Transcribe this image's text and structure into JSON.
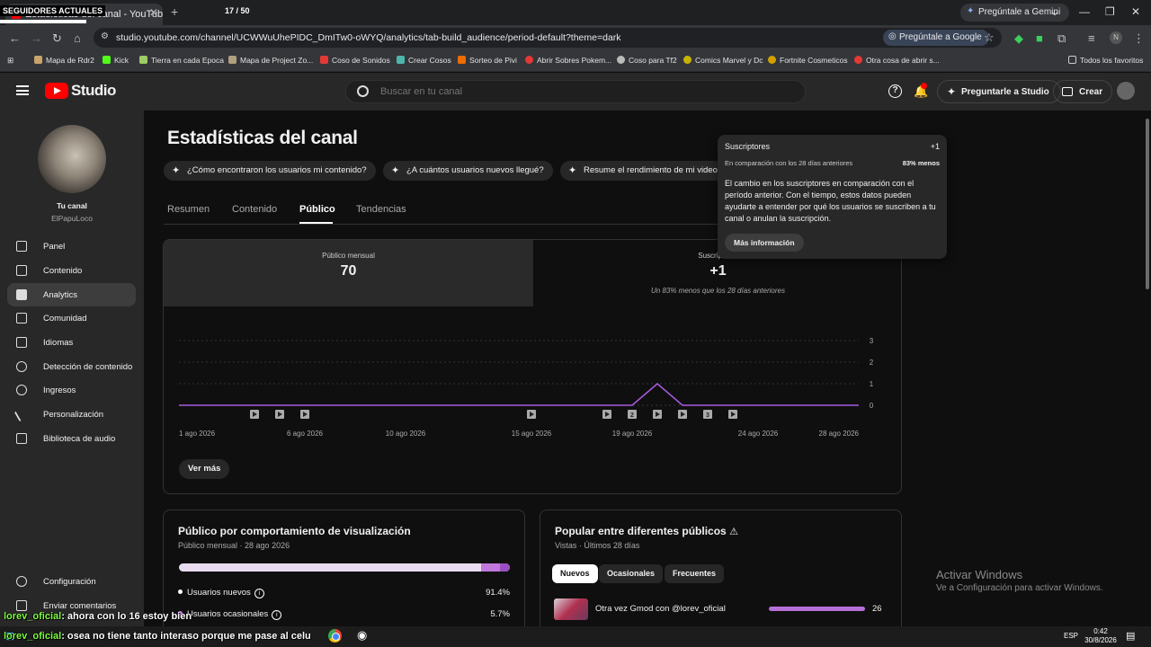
{
  "overlay": {
    "seguidores_label": "SEGUIDORES ACTUALES",
    "counter": "17 / 50"
  },
  "browser": {
    "tab_title": "Estadísticas del canal - YouTube",
    "gemini_button": "Pregúntale a Gemini",
    "url": "studio.youtube.com/channel/UCWWuUhePIDC_DmITw0-oWYQ/analytics/tab-build_audience/period-default?theme=dark",
    "ask_google": "Pregúntale a Google",
    "profile_initial": "N",
    "bookmarks": [
      "Mapa de Rdr2",
      "Kick",
      "Tierra en cada Epoca",
      "Mapa de Project Zo...",
      "Coso de Sonidos",
      "Crear Cosos",
      "Sorteo de Pivi",
      "Abrir Sobres Pokem...",
      "Coso para Tf2",
      "Comics Marvel y Dc",
      "Fortnite Cosmeticos",
      "Otra cosa de abrir s..."
    ],
    "bookmarks_all": "Todos los favoritos"
  },
  "header": {
    "logo_text": "Studio",
    "search_placeholder": "Buscar en tu canal",
    "ask_studio": "Preguntarle a Studio",
    "create": "Crear"
  },
  "sidebar": {
    "tu_canal": "Tu canal",
    "channel_name": "ElPapuLoco",
    "items": [
      {
        "label": "Panel",
        "icon": "dashboard-icon"
      },
      {
        "label": "Contenido",
        "icon": "content-icon"
      },
      {
        "label": "Analytics",
        "icon": "analytics-icon"
      },
      {
        "label": "Comunidad",
        "icon": "community-icon"
      },
      {
        "label": "Idiomas",
        "icon": "subtitles-icon"
      },
      {
        "label": "Detección de contenido",
        "icon": "copyright-icon"
      },
      {
        "label": "Ingresos",
        "icon": "earn-icon"
      },
      {
        "label": "Personalización",
        "icon": "customization-icon"
      },
      {
        "label": "Biblioteca de audio",
        "icon": "audio-library-icon"
      }
    ],
    "settings": "Configuración",
    "feedback": "Enviar comentarios"
  },
  "main": {
    "title": "Estadísticas del canal",
    "chips": [
      "¿Cómo encontraron los usuarios mi contenido?",
      "¿A cuántos usuarios nuevos llegué?",
      "Resume el rendimiento de mi video"
    ],
    "tabs": [
      "Resumen",
      "Contenido",
      "Público",
      "Tendencias"
    ],
    "active_tab": "Público",
    "metric_left": {
      "label": "Público mensual",
      "value": "70"
    },
    "metric_right": {
      "label": "Suscriptores",
      "value": "+1",
      "sub": "Un 83% menos que los 28 días anteriores"
    },
    "ver_mas": "Ver más"
  },
  "chart_data": {
    "type": "line",
    "x_ticks": [
      "1 ago 2026",
      "6 ago 2026",
      "10 ago 2026",
      "15 ago 2026",
      "19 ago 2026",
      "24 ago 2026",
      "28 ago 2026"
    ],
    "y_ticks": [
      "3",
      "2",
      "1",
      "0"
    ],
    "ylim": [
      0,
      3
    ],
    "series": [
      {
        "color": "#a95be0",
        "x": [
          "2026-08-01",
          "2026-08-02",
          "2026-08-03",
          "2026-08-04",
          "2026-08-05",
          "2026-08-06",
          "2026-08-07",
          "2026-08-08",
          "2026-08-09",
          "2026-08-10",
          "2026-08-11",
          "2026-08-12",
          "2026-08-13",
          "2026-08-14",
          "2026-08-15",
          "2026-08-16",
          "2026-08-17",
          "2026-08-18",
          "2026-08-19",
          "2026-08-20",
          "2026-08-21",
          "2026-08-22",
          "2026-08-23",
          "2026-08-24",
          "2026-08-25",
          "2026-08-26",
          "2026-08-27",
          "2026-08-28"
        ],
        "values": [
          0,
          0,
          0,
          0,
          0,
          0,
          0,
          0,
          0,
          0,
          0,
          0,
          0,
          0,
          0,
          0,
          0,
          0,
          0,
          1,
          0,
          0,
          0,
          0,
          0,
          0,
          0,
          0
        ]
      }
    ],
    "video_markers": [
      {
        "date": "2026-08-04",
        "label": ""
      },
      {
        "date": "2026-08-05",
        "label": ""
      },
      {
        "date": "2026-08-06",
        "label": ""
      },
      {
        "date": "2026-08-15",
        "label": ""
      },
      {
        "date": "2026-08-18",
        "label": ""
      },
      {
        "date": "2026-08-19",
        "label": "2"
      },
      {
        "date": "2026-08-20",
        "label": ""
      },
      {
        "date": "2026-08-21",
        "label": ""
      },
      {
        "date": "2026-08-22",
        "label": "3"
      },
      {
        "date": "2026-08-23",
        "label": ""
      }
    ]
  },
  "tooltip": {
    "title": "Suscriptores",
    "value": "+1",
    "compare": "En comparación con los 28 días anteriores",
    "percent": "83% menos",
    "body": "El cambio en los suscriptores en comparación con el período anterior. Con el tiempo, estos datos pueden ayudarte a entender por qué los usuarios se suscriben a tu canal o anulan la suscripción.",
    "more": "Más información"
  },
  "viewer_card": {
    "title": "Público por comportamiento de visualización",
    "sub": "Público mensual · 28 ago 2026",
    "segments": [
      {
        "label": "Usuarios nuevos",
        "pct": "91.4%",
        "value": 91.4
      },
      {
        "label": "Usuarios ocasionales",
        "pct": "5.7%",
        "value": 5.7
      },
      {
        "label": "",
        "pct": "",
        "value": 2.9
      }
    ]
  },
  "popular_card": {
    "title": "Popular entre diferentes públicos",
    "sub": "Vistas · Últimos 28 días",
    "chips": [
      "Nuevos",
      "Ocasionales",
      "Frecuentes"
    ],
    "item_title": "Otra vez Gmod con @lorev_oficial",
    "item_count": "26"
  },
  "windows": {
    "activate": "Activar Windows",
    "activate_sub": "Ve a Configuración para activar Windows."
  },
  "chat": [
    {
      "user": "lorev_oficial",
      "text": ": ahora con lo 16 estoy bien"
    },
    {
      "user": "lorev_oficial",
      "text": ": osea no tiene tanto interaso porque me pase al celu"
    }
  ],
  "tray": {
    "lang": "ESP",
    "time": "0:42",
    "date": "30/8/2026"
  }
}
